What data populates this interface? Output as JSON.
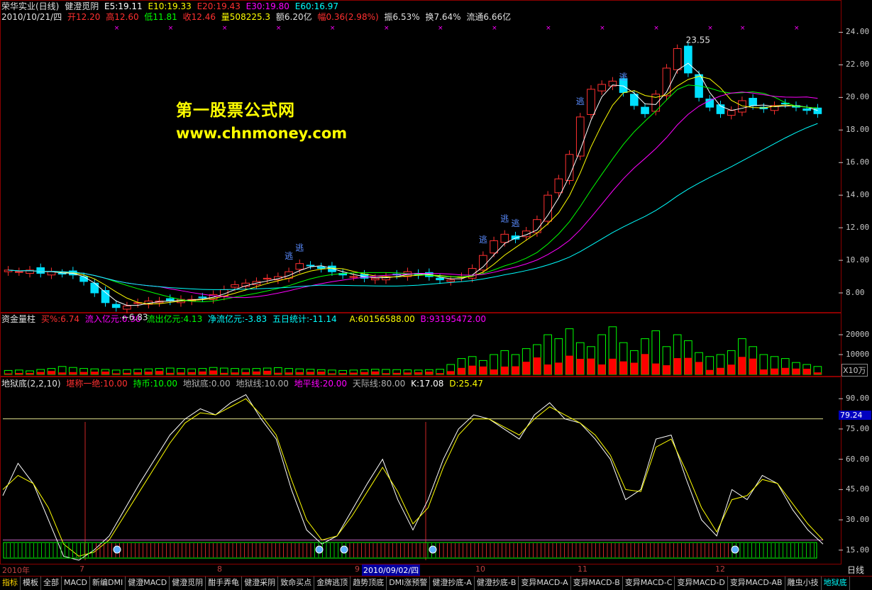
{
  "header1": {
    "name": "荣华实业(日线)",
    "indicator": "健澄觅阴",
    "e5": "E5:19.11",
    "e10": "E10:19.33",
    "e20": "E20:19.43",
    "e30": "E30:19.80",
    "e60": "E60:16.97"
  },
  "header2": {
    "date": "2010/10/21/四",
    "open": "开12.20",
    "high": "高12.60",
    "low": "低11.81",
    "close": "收12.46",
    "vol": "量508225.3",
    "amount": "额6.20亿",
    "change": "幅0.36(2.98%)",
    "amp": "振6.53%",
    "turnover": "换7.64%",
    "float": "流通6.66亿"
  },
  "watermark": {
    "line1": "第一股票公式网",
    "line2": "www.chnmoney.com"
  },
  "annotations": {
    "high": "23.55",
    "low": "6.83",
    "escape": "逃"
  },
  "panel2": {
    "title": "资金量柱",
    "buy": "买%:6.74",
    "inflow": "流入亿元:0.30",
    "outflow": "流出亿元:4.13",
    "net": "净流亿元:-3.83",
    "five": "五日统计:-11.14",
    "a": "A:60156588.00",
    "b": "B:93195472.00",
    "unit": "X10万"
  },
  "panel3": {
    "title": "地狱底(2,2,10)",
    "p1": "堪称一绝:10.00",
    "p2": "持币:10.00",
    "p3": "地狱底:0.00",
    "p4": "地狱线:10.00",
    "p5": "地平线:20.00",
    "p6": "天际线:80.00",
    "k": "K:17.08",
    "d": "D:25.47",
    "current": "79.24"
  },
  "axes": {
    "price_ticks": [
      "24.00",
      "22.00",
      "20.00",
      "18.00",
      "16.00",
      "14.00",
      "12.00",
      "10.00",
      "8.00"
    ],
    "vol_ticks": [
      "20000",
      "10000"
    ],
    "osc_ticks": [
      "90.00",
      "75.00",
      "60.00",
      "45.00",
      "30.00",
      "15.00"
    ]
  },
  "dates": {
    "year": "2010年",
    "m7": "7",
    "m8": "8",
    "m9": "9",
    "selected": "2010/09/02/四",
    "m10": "10",
    "m11": "11",
    "m12": "12",
    "period": "日线"
  },
  "tabs": [
    "指标",
    "模板",
    "全部",
    "MACD",
    "新编DMI",
    "健澄MACD",
    "健澄觅阴",
    "酣手弄龟",
    "健澄采阴",
    "致命买点",
    "金牌逃顶",
    "趋势顶底",
    "DMI涨预警",
    "健澄抄底-A",
    "健澄抄底-B",
    "变异MACD-A",
    "变异MACD-B",
    "变异MACD-C",
    "变异MACD-D",
    "变异MACD-AB",
    "雕虫小技",
    "地狱底"
  ],
  "colors": {
    "up": "#ff3030",
    "down": "#00e0ff",
    "ma5": "#ffffff",
    "ma10": "#ffff00",
    "ma20": "#00ff00",
    "ma30": "#ff00ff",
    "ma60": "#00ffff",
    "grid": "#8b0000"
  },
  "chart_data": [
    {
      "type": "candlestick",
      "ylim": [
        7,
        24.5
      ],
      "series": [
        {
          "name": "E5",
          "values": []
        },
        {
          "name": "E10",
          "values": []
        },
        {
          "name": "E20",
          "values": []
        },
        {
          "name": "E30",
          "values": []
        },
        {
          "name": "E60",
          "values": []
        }
      ],
      "close_path": [
        9.4,
        9.3,
        9.4,
        9.2,
        9.3,
        9.2,
        9.1,
        8.7,
        8.0,
        7.4,
        7.1,
        7.2,
        7.4,
        7.5,
        7.5,
        7.5,
        7.6,
        7.6,
        7.7,
        7.9,
        8.2,
        8.5,
        8.6,
        8.7,
        8.9,
        9.0,
        9.3,
        9.8,
        9.7,
        9.5,
        9.3,
        9.1,
        9.0,
        8.9,
        8.9,
        9.0,
        9.1,
        9.3,
        9.1,
        9.0,
        8.8,
        8.8,
        9.0,
        9.5,
        10.3,
        11.2,
        11.6,
        11.3,
        11.8,
        12.5,
        14.0,
        15.0,
        16.5,
        18.8,
        20.5,
        20.8,
        21.0,
        20.3,
        19.5,
        19.0,
        20.2,
        21.8,
        23.0,
        21.5,
        20.0,
        19.4,
        19.0,
        19.2,
        19.8,
        19.5,
        19.3,
        19.5,
        19.6,
        19.4,
        19.2,
        19.0
      ]
    },
    {
      "type": "bar",
      "ylim": [
        0,
        25000
      ],
      "values": [
        2000,
        2200,
        1800,
        2500,
        3000,
        4000,
        3500,
        3000,
        2800,
        2500,
        2200,
        2400,
        2600,
        2800,
        3000,
        3200,
        3000,
        2800,
        3000,
        3500,
        3200,
        3000,
        2800,
        3000,
        3200,
        3400,
        3000,
        2800,
        2600,
        2400,
        2200,
        2000,
        2200,
        2400,
        2600,
        2500,
        2400,
        2300,
        2200,
        2400,
        2600,
        5000,
        8000,
        9000,
        7000,
        10000,
        12000,
        10000,
        13000,
        15000,
        20000,
        18000,
        23000,
        16000,
        14000,
        20000,
        24000,
        16000,
        12000,
        18000,
        22000,
        14000,
        20000,
        17000,
        11000,
        9000,
        10000,
        12000,
        18000,
        14000,
        10000,
        9000,
        8000,
        6000,
        5000,
        4000
      ]
    },
    {
      "type": "line",
      "ylim": [
        10,
        95
      ],
      "series": [
        {
          "name": "K",
          "values": [
            42,
            58,
            48,
            30,
            12,
            10,
            15,
            22,
            35,
            48,
            60,
            72,
            80,
            85,
            82,
            88,
            92,
            80,
            70,
            45,
            25,
            18,
            22,
            35,
            48,
            60,
            40,
            25,
            40,
            60,
            75,
            82,
            80,
            75,
            70,
            82,
            88,
            80,
            78,
            70,
            60,
            40,
            45,
            70,
            72,
            50,
            30,
            22,
            45,
            40,
            52,
            48,
            35,
            25,
            18
          ]
        },
        {
          "name": "D",
          "values": [
            45,
            52,
            48,
            36,
            18,
            12,
            14,
            20,
            32,
            44,
            56,
            68,
            78,
            83,
            82,
            86,
            90,
            82,
            72,
            50,
            30,
            20,
            22,
            32,
            44,
            56,
            44,
            28,
            36,
            56,
            72,
            80,
            80,
            76,
            72,
            80,
            86,
            82,
            78,
            72,
            62,
            45,
            44,
            66,
            70,
            54,
            36,
            24,
            40,
            42,
            50,
            48,
            38,
            28,
            20
          ]
        }
      ]
    }
  ]
}
